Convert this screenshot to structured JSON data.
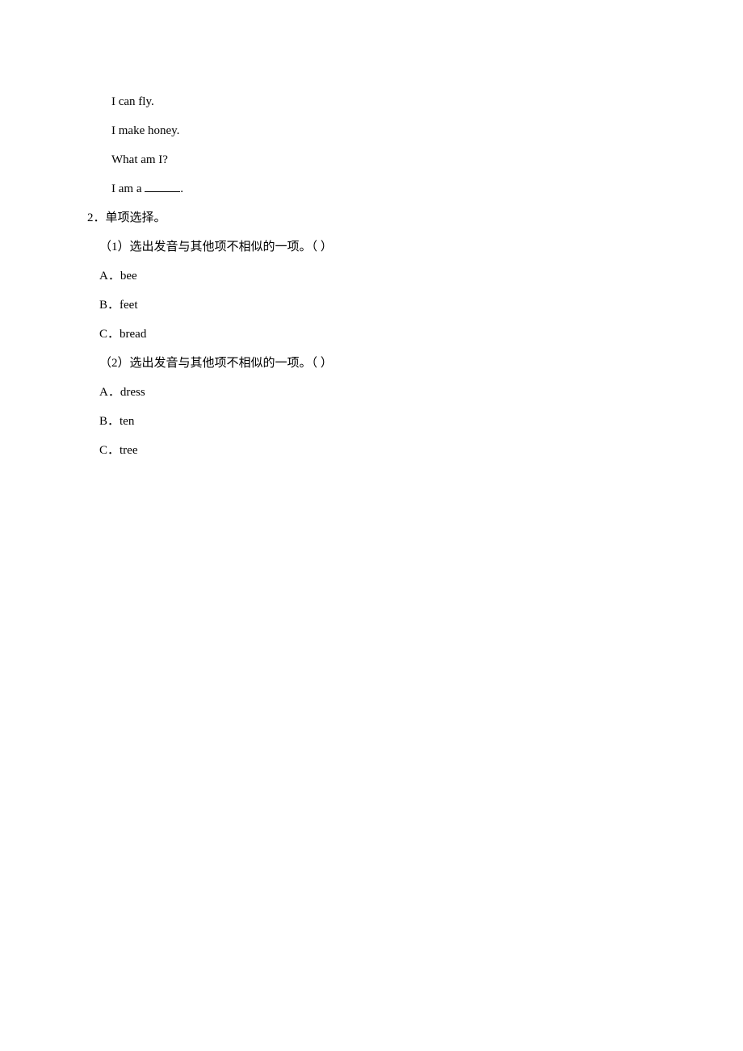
{
  "riddle": {
    "line1": "I can fly.",
    "line2": "I make honey.",
    "line3": "What am I?",
    "line4_prefix": "I am a ",
    "line4_suffix": "."
  },
  "q2": {
    "number": "2．",
    "title": "单项选择。",
    "sub1": {
      "label": "（1）",
      "text": "选出发音与其他项不相似的一项。（  ）",
      "A": "A．bee",
      "B": "B．feet",
      "C": "C．bread"
    },
    "sub2": {
      "label": "（2）",
      "text": "选出发音与其他项不相似的一项。（  ）",
      "A": "A．dress",
      "B": "B．ten",
      "C": "C．tree"
    }
  }
}
